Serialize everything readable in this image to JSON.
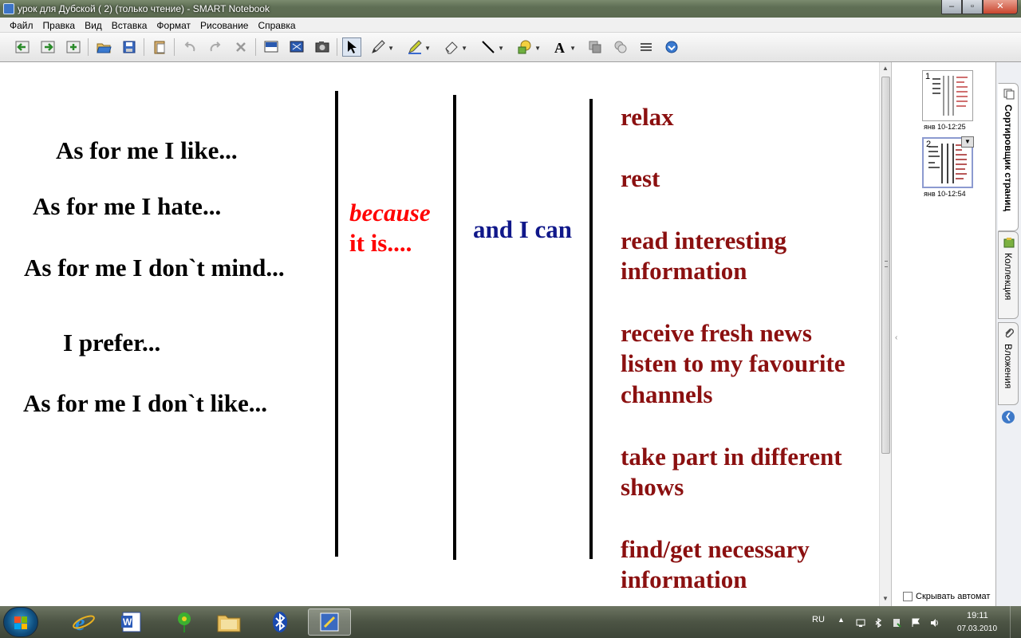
{
  "window": {
    "title": "урок для Дубской ( 2) (только чтение) - SMART Notebook",
    "minimize": "–",
    "maximize": "▫",
    "close": "✕"
  },
  "menu": [
    "Файл",
    "Правка",
    "Вид",
    "Вставка",
    "Формат",
    "Рисование",
    "Справка"
  ],
  "toolbar_icons": [
    "back-page-icon",
    "forward-page-icon",
    "add-page-icon",
    "open-folder-icon",
    "save-icon",
    "paste-icon",
    "undo-icon",
    "redo-icon",
    "delete-icon",
    "screen-shade-icon",
    "full-screen-icon",
    "screen-capture-icon",
    "select-arrow-icon",
    "pen-icon",
    "creative-pen-icon",
    "eraser-icon",
    "line-icon",
    "shapes-icon",
    "text-icon",
    "fill-icon",
    "properties-icon",
    "move-toolbar-icon",
    "more-icon"
  ],
  "canvas": {
    "left_phrases": [
      "As for me I like...",
      "As for me I hate...",
      "As for me I don`t mind...",
      "I prefer...",
      "As for me I don`t like..."
    ],
    "because_line1": "because",
    "because_line2": "it is....",
    "and_i_can": "and I can",
    "activities": [
      "relax",
      "rest",
      "read interesting",
      "information",
      "receive fresh news",
      "listen to my favourite",
      "channels",
      "take part in different",
      "shows",
      "find/get necessary",
      "information"
    ],
    "colors": {
      "left_text": "#000000",
      "because": "#ff0000",
      "and_i_can": "#10188a",
      "activities": "#8b1010"
    }
  },
  "page_sorter": {
    "pages": [
      {
        "number": "1",
        "caption": "янв 10-12:25"
      },
      {
        "number": "2",
        "caption": "янв 10-12:54"
      }
    ],
    "autohide_label": "Скрывать автомат"
  },
  "side_tabs": [
    "Сортировщик страниц",
    "Коллекция",
    "Вложения"
  ],
  "taskbar": {
    "language": "RU",
    "time": "19:11",
    "date": "07.03.2010",
    "apps": [
      "internet-explorer-icon",
      "word-icon",
      "flower-gadget-icon",
      "folder-icon",
      "bluetooth-icon",
      "smart-notebook-icon"
    ]
  }
}
